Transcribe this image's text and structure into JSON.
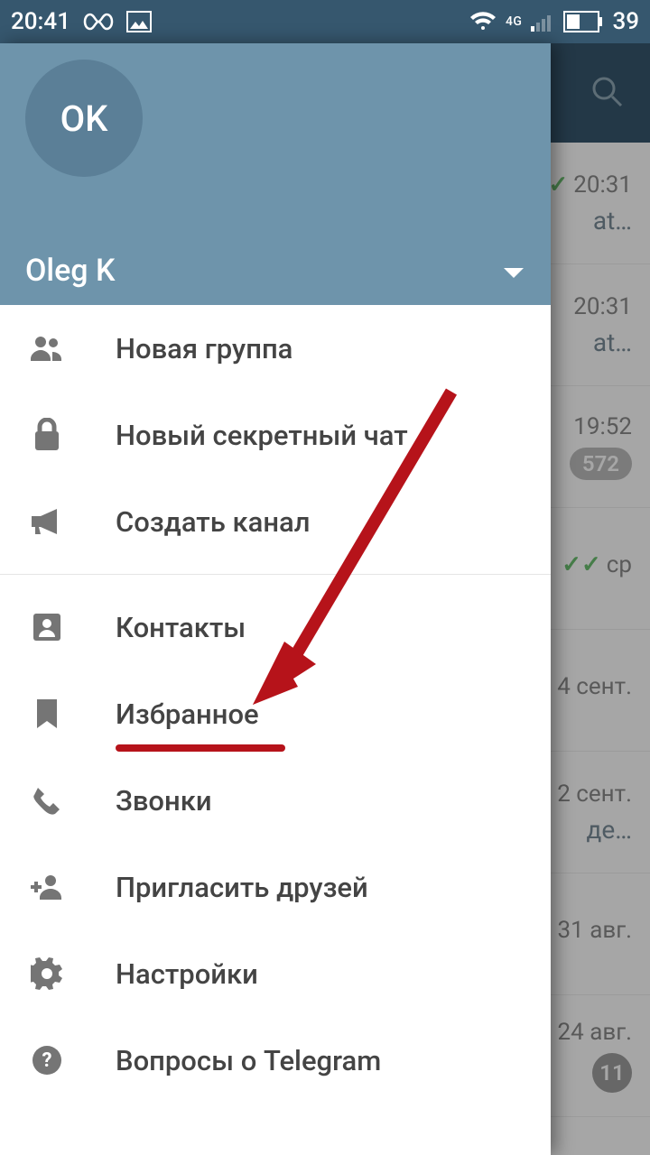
{
  "statusbar": {
    "time": "20:41",
    "network": "4G",
    "battery": "39"
  },
  "drawer": {
    "avatar_initials": "OK",
    "username": "Oleg K",
    "items": [
      {
        "icon": "group",
        "label": "Новая группа"
      },
      {
        "icon": "lock",
        "label": "Новый секретный чат"
      },
      {
        "icon": "channel",
        "label": "Создать канал"
      }
    ],
    "items2": [
      {
        "icon": "contacts",
        "label": "Контакты"
      },
      {
        "icon": "bookmark",
        "label": "Избранное"
      },
      {
        "icon": "calls",
        "label": "Звонки"
      },
      {
        "icon": "invite",
        "label": "Пригласить друзей"
      },
      {
        "icon": "settings",
        "label": "Настройки"
      },
      {
        "icon": "help",
        "label": "Вопросы о Telegram"
      }
    ]
  },
  "annotation": {
    "target_item_label": "Избранное",
    "color": "#b6131a"
  },
  "chatlist": {
    "rows": [
      {
        "time": "20:31",
        "snippet": "at…",
        "check": true
      },
      {
        "time": "20:31",
        "snippet": "at…"
      },
      {
        "time": "19:52",
        "badge": "572"
      },
      {
        "time": "ср",
        "doublecheck": true
      },
      {
        "time": "4 сент."
      },
      {
        "time": "2 сент.",
        "snippet": "де…"
      },
      {
        "time": "31 авг."
      },
      {
        "time": "24 авг.",
        "badge_small": "11"
      }
    ]
  }
}
